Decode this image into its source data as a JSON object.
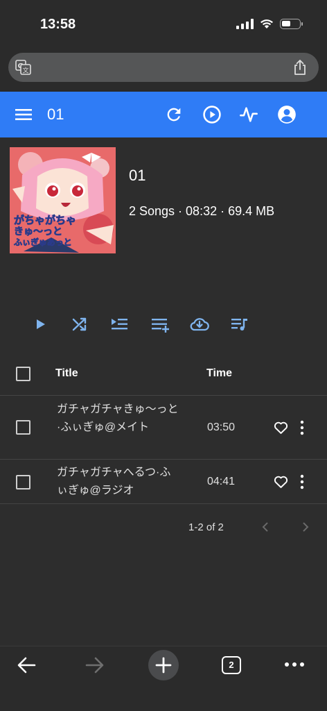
{
  "status_bar": {
    "time": "13:58"
  },
  "app_bar": {
    "title": "01"
  },
  "album": {
    "name": "01",
    "info": "2 Songs · 08:32 · 69.4 MB",
    "cover_lines": [
      "がちゃがちゃ",
      "きゅ～っと",
      "ふぃぎゅあっと"
    ]
  },
  "table": {
    "headers": {
      "title": "Title",
      "time": "Time"
    },
    "rows": [
      {
        "title": "ガチャガチャきゅ～っと·ふぃぎゅ@メイト",
        "time": "03:50"
      },
      {
        "title": "ガチャガチャへるつ·ふぃぎゅ@ラジオ",
        "time": "04:41"
      }
    ]
  },
  "pager": {
    "range": "1-2 of 2"
  },
  "browser": {
    "tab_count": "2"
  },
  "colors": {
    "accent": "#2f7cf6",
    "icon": "#7fb4ee",
    "background": "#2d2d2d"
  }
}
